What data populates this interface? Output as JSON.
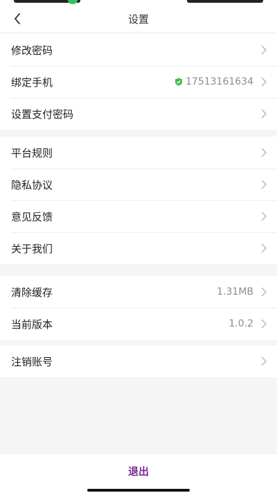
{
  "header": {
    "title": "设置"
  },
  "groups": [
    {
      "items": [
        {
          "label": "修改密码"
        },
        {
          "label": "绑定手机",
          "value": "17513161634"
        },
        {
          "label": "设置支付密码"
        }
      ]
    },
    {
      "items": [
        {
          "label": "平台规则"
        },
        {
          "label": "隐私协议"
        },
        {
          "label": "意见反馈"
        },
        {
          "label": "关于我们"
        }
      ]
    },
    {
      "items": [
        {
          "label": "清除缓存",
          "value": "1.31MB"
        },
        {
          "label": "当前版本",
          "value": "1.0.2"
        }
      ]
    },
    {
      "items": [
        {
          "label": "注销账号"
        }
      ]
    }
  ],
  "footer": {
    "logout_label": "退出"
  },
  "colors": {
    "accent": "#7a2b8f",
    "verified": "#3bbf5a"
  }
}
